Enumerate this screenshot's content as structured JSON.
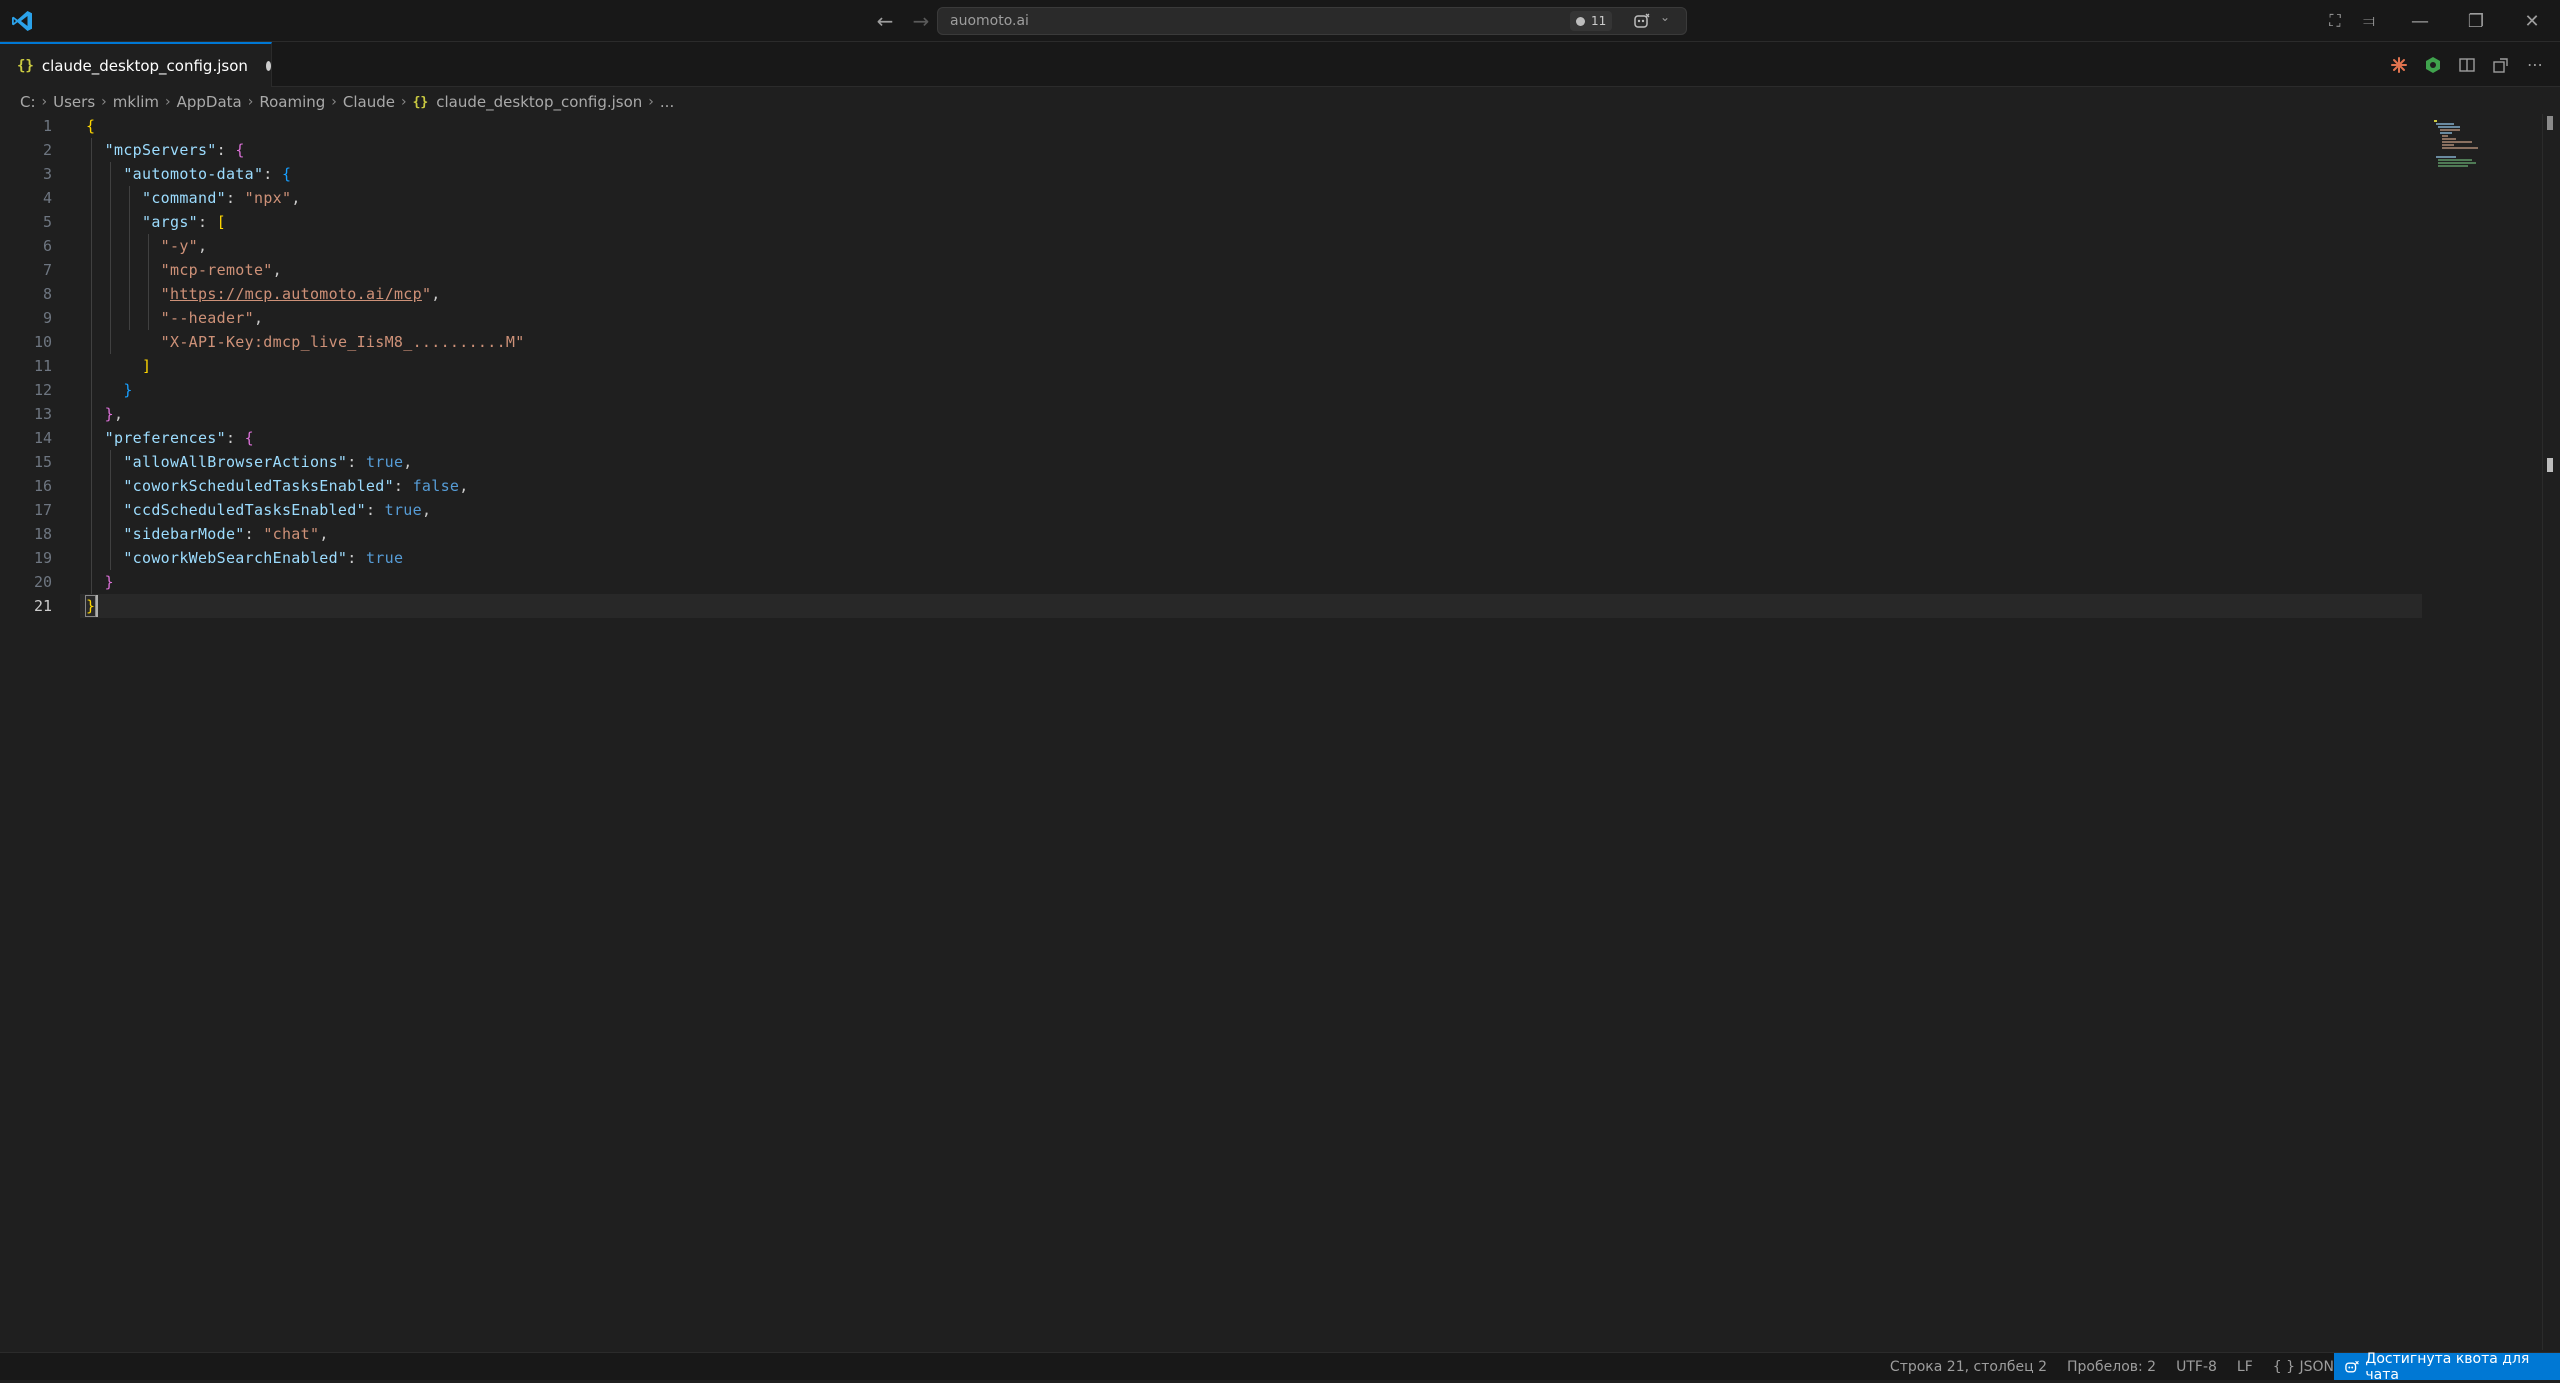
{
  "titlebar": {
    "search_text": "auomoto.ai",
    "badge_count": "11",
    "colors": {
      "background": "#181818",
      "accent": "#0078d4"
    }
  },
  "tabs": [
    {
      "label": "claude_desktop_config.json",
      "icon": "json-file-icon",
      "dirty": true
    }
  ],
  "breadcrumb": [
    "C:",
    "Users",
    "mklim",
    "AppData",
    "Roaming",
    "Claude",
    "claude_desktop_config.json",
    "..."
  ],
  "editor": {
    "line_numbers": [
      "1",
      "2",
      "3",
      "4",
      "5",
      "6",
      "7",
      "8",
      "9",
      "10",
      "11",
      "12",
      "13",
      "14",
      "15",
      "16",
      "17",
      "18",
      "19",
      "20",
      "21"
    ],
    "active_line": 21,
    "code": {
      "mcpServers_key": "\"mcpServers\"",
      "automoto_key": "\"automoto-data\"",
      "command_key": "\"command\"",
      "command_val": "\"npx\"",
      "args_key": "\"args\"",
      "arg1": "\"-y\"",
      "arg2": "\"mcp-remote\"",
      "arg3_q": "\"",
      "arg3_url": "https://mcp.automoto.ai/mcp",
      "arg4": "\"--header\"",
      "arg5": "\"X-API-Key:dmcp_live_IisM8_..........M\"",
      "preferences_key": "\"preferences\"",
      "pref1_key": "\"allowAllBrowserActions\"",
      "pref1_val": "true",
      "pref2_key": "\"coworkScheduledTasksEnabled\"",
      "pref2_val": "false",
      "pref3_key": "\"ccdScheduledTasksEnabled\"",
      "pref3_val": "true",
      "pref4_key": "\"sidebarMode\"",
      "pref4_val": "\"chat\"",
      "pref5_key": "\"coworkWebSearchEnabled\"",
      "pref5_val": "true"
    }
  },
  "statusbar": {
    "position": "Строка 21, столбец 2",
    "indent": "Пробелов: 2",
    "encoding": "UTF-8",
    "eol": "LF",
    "language_icon": "{ }",
    "language": "JSON",
    "quota": "Достигнута квота для чата"
  }
}
